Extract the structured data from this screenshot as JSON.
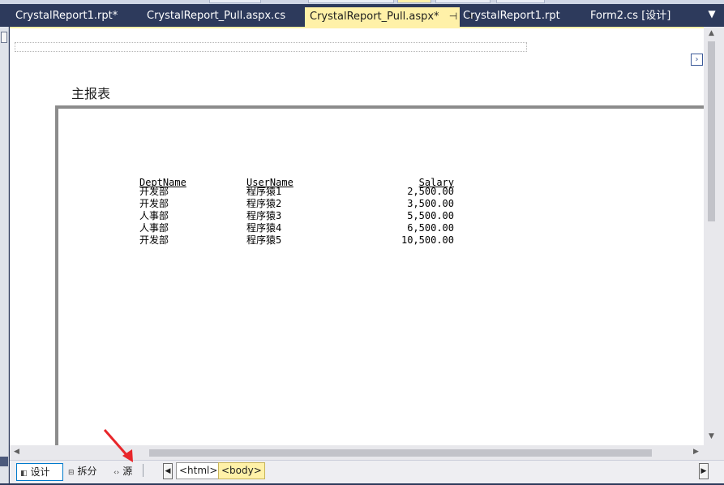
{
  "tabs": [
    {
      "label": "CrystalReport1.rpt*",
      "active": false
    },
    {
      "label": "CrystalReport_Pull.aspx.cs",
      "active": false
    },
    {
      "label": "CrystalReport_Pull.aspx*",
      "active": true
    },
    {
      "label": "CrystalReport1.rpt",
      "active": false
    },
    {
      "label": "Form2.cs [设计]",
      "active": false
    }
  ],
  "icons": {
    "pin": "⊣",
    "close": "✕",
    "menu": "▼",
    "expand": "›",
    "up": "▲",
    "down": "▼",
    "left": "◀",
    "right": "▶",
    "design": "◧",
    "split": "⊟",
    "source": "‹›"
  },
  "report": {
    "title": "主报表",
    "headers": {
      "dept": "DeptName",
      "user": "UserName",
      "salary": "Salary"
    },
    "rows": [
      {
        "dept": "开发部",
        "user": "程序猿1",
        "salary": "2,500.00"
      },
      {
        "dept": "开发部",
        "user": "程序猿2",
        "salary": "3,500.00"
      },
      {
        "dept": "人事部",
        "user": "程序猿3",
        "salary": "5,500.00"
      },
      {
        "dept": "人事部",
        "user": "程序猿4",
        "salary": "6,500.00"
      },
      {
        "dept": "开发部",
        "user": "程序猿5",
        "salary": "10,500.00"
      }
    ]
  },
  "bottom": {
    "design": "设计",
    "split": "拆分",
    "source": "源",
    "crumb_html": "<html>",
    "crumb_body": "<body>"
  },
  "colors": {
    "active_tab": "#fff1a8",
    "tab_bar": "#2d3a5c",
    "annotation_arrow": "#e8262a"
  }
}
